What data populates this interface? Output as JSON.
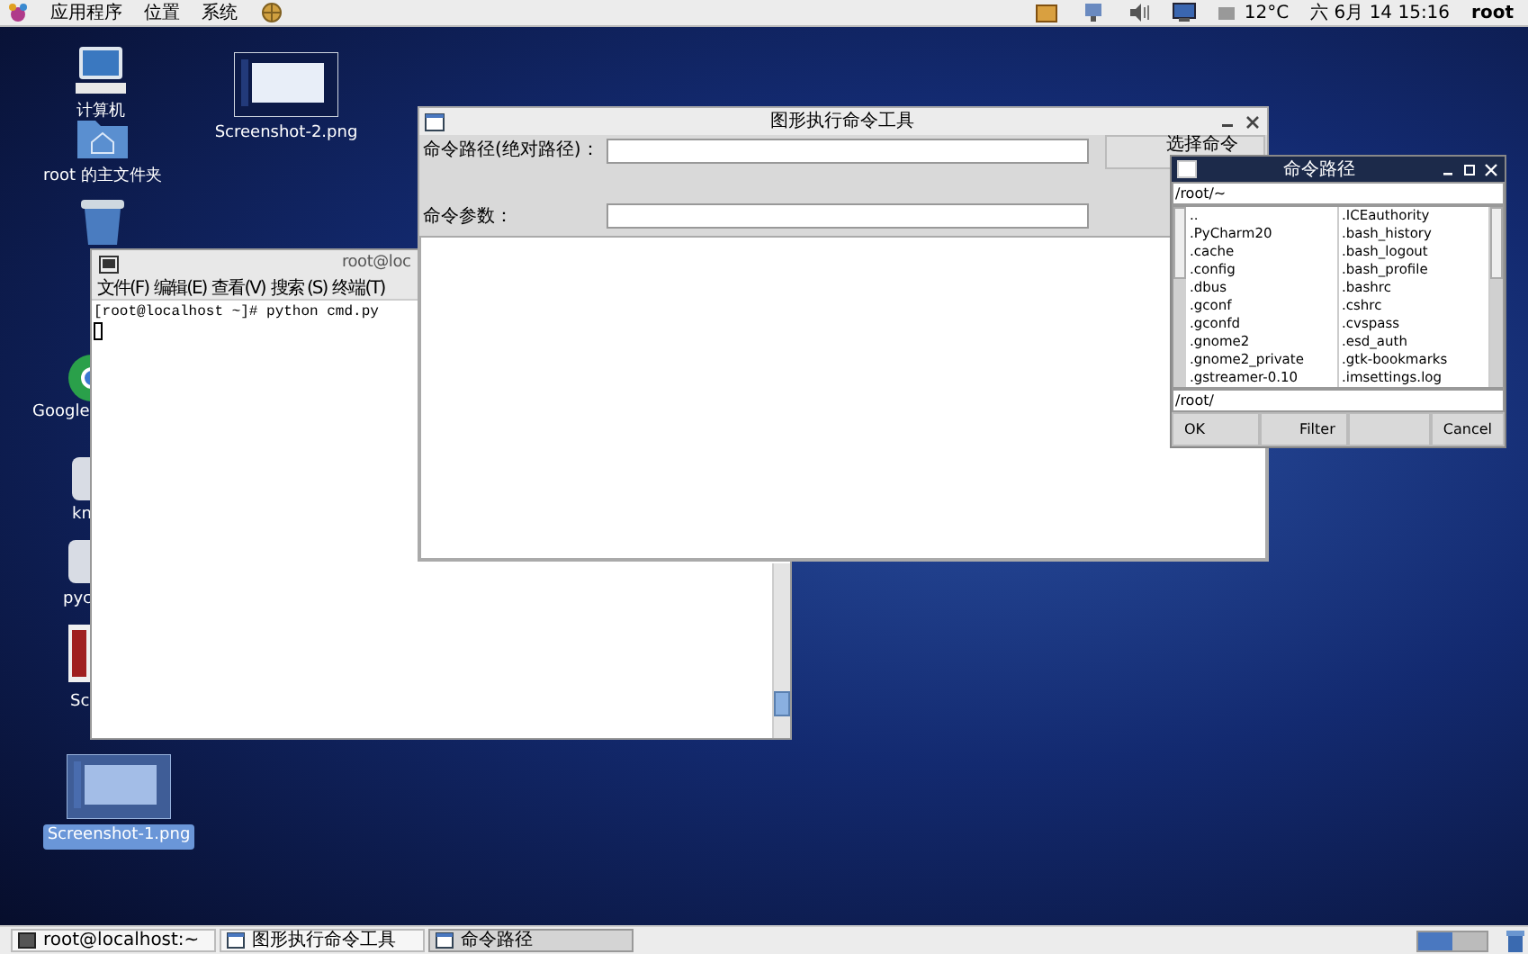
{
  "top_panel": {
    "menus": [
      "应用程序",
      "位置",
      "系统"
    ],
    "weather": "12°C",
    "clock": "六 6月 14 15:16",
    "user": "root"
  },
  "desktop_icons": [
    {
      "kind": "computer",
      "label": "计算机",
      "selected": false
    },
    {
      "kind": "home",
      "label": "root 的主文件夹",
      "selected": false
    },
    {
      "kind": "trash",
      "selected": false
    },
    {
      "kind": "image",
      "label": "Screenshot-2.png",
      "selected": false
    },
    {
      "kind": "chrome",
      "label": "Google",
      "selected": false
    },
    {
      "kind": "app",
      "label": "kn",
      "selected": false
    },
    {
      "kind": "app",
      "label": "pyc",
      "selected": false
    },
    {
      "kind": "doc",
      "label": "Sc",
      "selected": false
    },
    {
      "kind": "image",
      "label": "Screenshot-1.png",
      "selected": true
    }
  ],
  "terminal": {
    "title": "root@loc",
    "menus": [
      "文件(F)",
      "编辑(E)",
      "查看(V)",
      "搜索 (S)",
      "终端(T)"
    ],
    "lines": [
      "[root@localhost ~]# python cmd.py"
    ]
  },
  "main_window": {
    "title": "图形执行命令工具",
    "path_label": "命令路径(绝对路径)：",
    "args_label": "命令参数：",
    "choose_button": "选择命令"
  },
  "dialog": {
    "title": "命令路径",
    "path": "/root/~",
    "left_files": [
      "..",
      ".PyCharm20",
      ".cache",
      ".config",
      ".dbus",
      ".gconf",
      ".gconfd",
      ".gnome2",
      ".gnome2_private",
      ".gstreamer-0.10"
    ],
    "right_files": [
      ".ICEauthority",
      ".bash_history",
      ".bash_logout",
      ".bash_profile",
      ".bashrc",
      ".cshrc",
      ".cvspass",
      ".esd_auth",
      ".gtk-bookmarks",
      ".imsettings.log"
    ],
    "entry": "/root/",
    "buttons": [
      "OK",
      "Filter",
      "Cancel"
    ]
  },
  "taskbar": [
    {
      "kind": "terminal",
      "label": "root@localhost:~",
      "selected": false
    },
    {
      "kind": "window",
      "label": "图形执行命令工具",
      "selected": false
    },
    {
      "kind": "window",
      "label": "命令路径",
      "selected": true
    }
  ]
}
